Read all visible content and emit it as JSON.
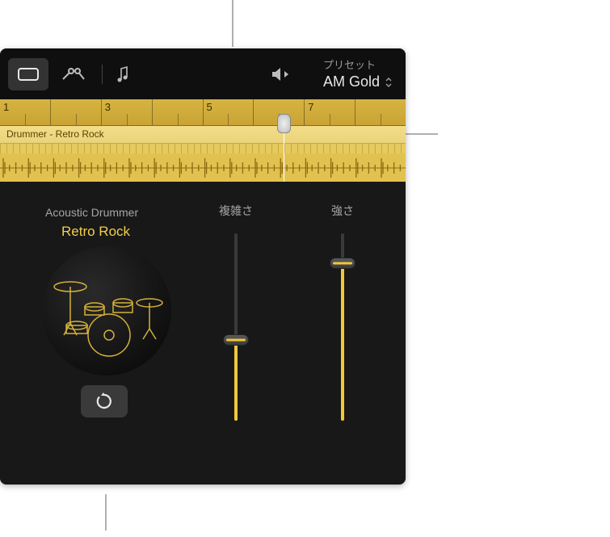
{
  "preset": {
    "label": "プリセット",
    "value": "AM Gold"
  },
  "ruler": {
    "bars": [
      "1",
      "",
      "3",
      "",
      "5",
      "",
      "7",
      ""
    ]
  },
  "track": {
    "title": "Drummer - Retro Rock",
    "playhead_pct": 70
  },
  "drummer": {
    "category": "Acoustic Drummer",
    "style": "Retro Rock"
  },
  "sliders": {
    "complexity": {
      "label": "複雑さ",
      "value_pct": 43
    },
    "intensity": {
      "label": "強さ",
      "value_pct": 84
    }
  },
  "icons": {
    "region": "region-icon",
    "automation": "automation-curve-icon",
    "notes": "notes-icon",
    "preview": "speaker-play-icon",
    "reload": "reload-icon",
    "dropdown": "updown-chevron-icon"
  },
  "colors": {
    "accent": "#f0c838",
    "bg": "#181818"
  }
}
